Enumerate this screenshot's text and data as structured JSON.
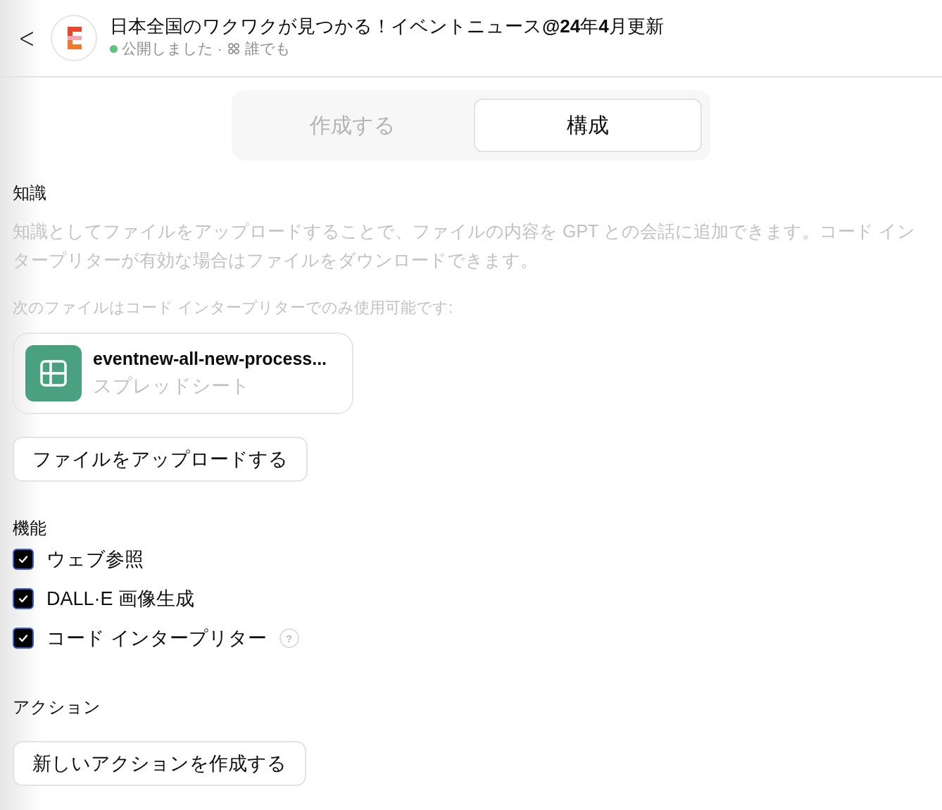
{
  "header": {
    "back": "<",
    "title": "日本全国のワクワクが見つかる！イベントニュース**@24**年**4**月更新",
    "status": {
      "text": "公開しました ·",
      "published": true
    },
    "audience": "誰でも"
  },
  "tabs": [
    {
      "label": "作成する",
      "selected": false
    },
    {
      "label": "構成",
      "selected": true
    }
  ],
  "knowledge": {
    "heading": "知識",
    "description": "知識としてファイルをアップロードすることで、ファイルの内容を GPT との会話に追加できます。コード インタープリターが有効な場合はファイルをダウンロードできます。",
    "note": "次のファイルはコード インタープリターでのみ使用可能です:",
    "files": [
      {
        "name": "eventnew-all-new-process...",
        "type": "スプレッドシート"
      }
    ],
    "upload_button": "ファイルをアップロードする"
  },
  "capabilities": {
    "heading": "機能",
    "items": [
      {
        "label": "ウェブ参照",
        "checked": true
      },
      {
        "label": "DALL·E 画像生成",
        "checked": true
      },
      {
        "label": "コード インタープリター",
        "checked": true,
        "help": "?"
      }
    ]
  },
  "actions": {
    "heading": "アクション",
    "create_button": "新しいアクションを作成する"
  }
}
